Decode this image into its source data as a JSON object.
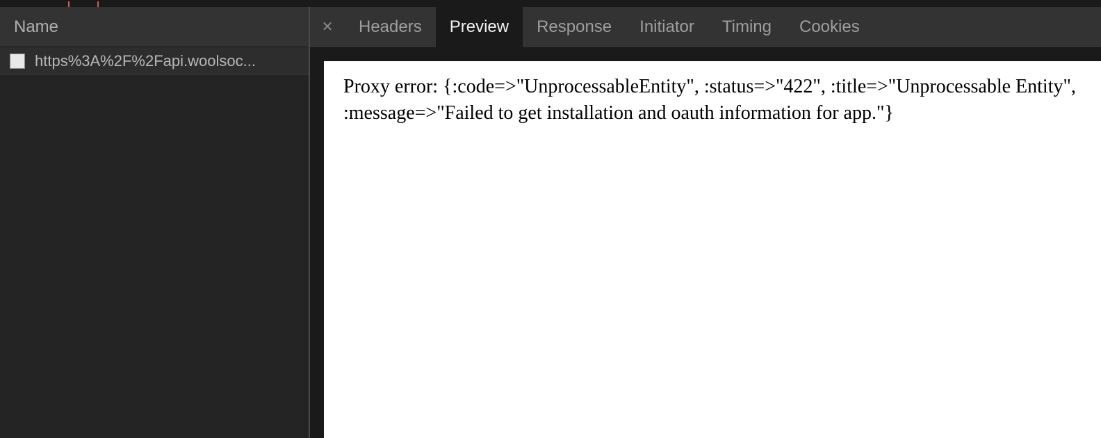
{
  "sidebar": {
    "header_label": "Name",
    "requests": [
      {
        "url": "https%3A%2F%2Fapi.woolsoc..."
      }
    ]
  },
  "detail": {
    "close_glyph": "✕",
    "tabs": [
      {
        "label": "Headers",
        "active": false
      },
      {
        "label": "Preview",
        "active": true
      },
      {
        "label": "Response",
        "active": false
      },
      {
        "label": "Initiator",
        "active": false
      },
      {
        "label": "Timing",
        "active": false
      },
      {
        "label": "Cookies",
        "active": false
      }
    ],
    "preview_body": "Proxy error: {:code=>\"UnprocessableEntity\", :status=>\"422\", :title=>\"Unprocessable Entity\", :message=>\"Failed to get installation and oauth information for app.\"}"
  }
}
